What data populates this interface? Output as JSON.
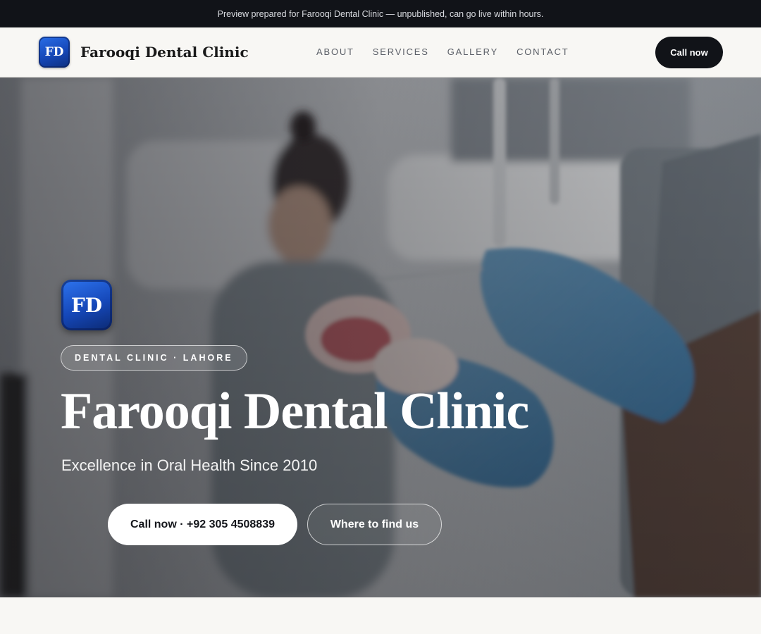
{
  "announcement": "Preview prepared for Farooqi Dental Clinic — unpublished, can go live within hours.",
  "header": {
    "logo_text": "FD",
    "brand_name": "Farooqi Dental Clinic",
    "nav": [
      "ABOUT",
      "SERVICES",
      "GALLERY",
      "CONTACT"
    ],
    "cta_label": "Call now"
  },
  "hero": {
    "logo_text": "FD",
    "badge": "DENTAL CLINIC · LAHORE",
    "title": "Farooqi Dental Clinic",
    "subtitle": "Excellence in Oral Health Since 2010",
    "primary_button": "Call now · +92 305 4508839",
    "secondary_button": "Where to find us",
    "background_image": "dentist-holding-denture-model"
  },
  "colors": {
    "dark": "#111318",
    "background": "#f8f7f4",
    "logo_blue": "#1547b8",
    "white": "#ffffff"
  }
}
